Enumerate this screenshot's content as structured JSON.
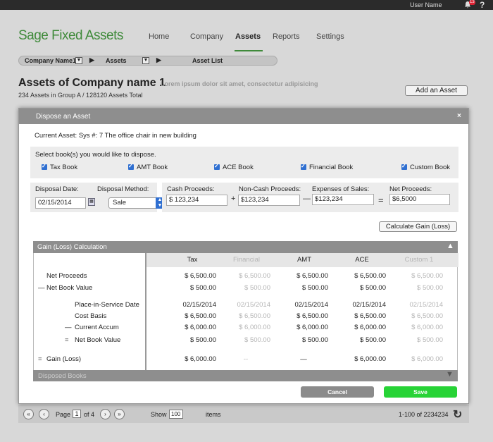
{
  "topbar": {
    "user_name": "User Name",
    "notif_count": "13",
    "help": "?"
  },
  "app": {
    "logo": "Sage Fixed Assets",
    "nav": [
      "Home",
      "Company",
      "Assets",
      "Reports",
      "Settings"
    ],
    "active_nav": "Assets",
    "breadcrumb": [
      "Company Name1",
      "Assets",
      "Asset List"
    ],
    "page_title": "Assets of Company name 1",
    "page_subtitle": "Lorem ipsum dolor sit amet, consectetur adipisicing",
    "asset_count": "234 Assets in Group A / 128120 Assets Total",
    "add_asset_label": "Add an Asset"
  },
  "pager": {
    "page_label": "Page",
    "page_value": "1",
    "of_label": "of 4",
    "show_label": "Show",
    "show_value": "100",
    "items_label": "items",
    "range": "1-100 of 2234234"
  },
  "modal": {
    "title": "Dispose an  Asset",
    "close": "×",
    "current_asset": "Current Asset: Sys #: 7   The office chair in new building",
    "books_prompt": "Select book(s) you would like to dispose.",
    "books": [
      "Tax Book",
      "AMT Book",
      "ACE Book",
      "Financial Book",
      "Custom Book"
    ],
    "disposal_date_label": "Disposal Date:",
    "disposal_date": "02/15/2014",
    "disposal_method_label": "Disposal Method:",
    "disposal_method": "Sale",
    "cash_label": "Cash Proceeds:",
    "cash_value": "$ 123,234",
    "noncash_label": "Non-Cash Proceeds:",
    "noncash_value": "$123,234",
    "expenses_label": "Expenses of Sales:",
    "expenses_value": "$123,234",
    "net_label": "Net Proceeds:",
    "net_value": "$6,5000",
    "op_plus": "+",
    "op_minus": "—",
    "op_equals": "=",
    "calc_button": "Calculate Gain (Loss)",
    "gl_title": "Gain (Loss) Calculation",
    "gl_columns": [
      "Tax",
      "Financial",
      "AMT",
      "ACE",
      "Custom 1"
    ],
    "gl_rows": [
      {
        "label": "Net Proceeds",
        "prefix": "",
        "values": [
          "$ 6,500.00",
          "$ 6,500.00",
          "$ 6,500.00",
          "$ 6,500.00",
          "$ 6,500.00"
        ]
      },
      {
        "label": "Net Book Value",
        "prefix": "—",
        "values": [
          "$ 500.00",
          "$ 500.00",
          "$ 500.00",
          "$ 500.00",
          "$ 500.00"
        ]
      },
      {
        "label": "Place-in-Service Date",
        "prefix": "",
        "values": [
          "02/15/2014",
          "02/15/2014",
          "02/15/2014",
          "02/15/2014",
          "02/15/2014"
        ]
      },
      {
        "label": "Cost Basis",
        "prefix": "",
        "values": [
          "$ 6,500.00",
          "$ 6,500.00",
          "$ 6,500.00",
          "$ 6,500.00",
          "$ 6,500.00"
        ]
      },
      {
        "label": "Current Accum",
        "prefix": "—",
        "values": [
          "$ 6,000.00",
          "$ 6,000.00",
          "$ 6,000.00",
          "$ 6,000.00",
          "$ 6,000.00"
        ]
      },
      {
        "label": "Net Book Value",
        "prefix": "=",
        "values": [
          "$ 500.00",
          "$ 500.00",
          "$ 500.00",
          "$ 500.00",
          "$ 500.00"
        ]
      },
      {
        "label": "Gain (Loss)",
        "prefix": "=",
        "values": [
          "$ 6,000.00",
          "--",
          "—",
          "$ 6,000.00",
          "$ 6,000.00"
        ]
      }
    ],
    "disposed_books": "Disposed Books",
    "cancel": "Cancel",
    "save": "Save"
  },
  "colors": {
    "accent_green": "#3f8a3a",
    "save_green": "#27d336",
    "checkbox_blue": "#2f6fd1",
    "header_gray": "#8e8e8e"
  }
}
